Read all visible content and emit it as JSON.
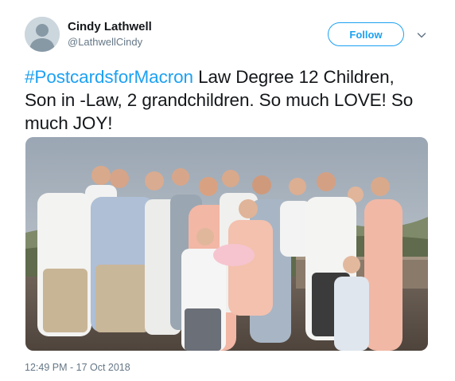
{
  "tweet": {
    "author": {
      "display_name": "Cindy Lathwell",
      "screen_name": "@LathwellCindy",
      "avatar_icon": "default-avatar-icon"
    },
    "follow_label": "Follow",
    "caret_icon": "chevron-down-icon",
    "text": {
      "hashtag": "#PostcardsforMacron",
      "body": " Law Degree 12 Children, Son in -Law, 2 grandchildren. So much LOVE! So much JOY!"
    },
    "timestamp": "12:49 PM - 17 Oct 2018"
  },
  "colors": {
    "brand_blue": "#1da1f2",
    "text_primary": "#14171a",
    "text_secondary": "#657786"
  }
}
